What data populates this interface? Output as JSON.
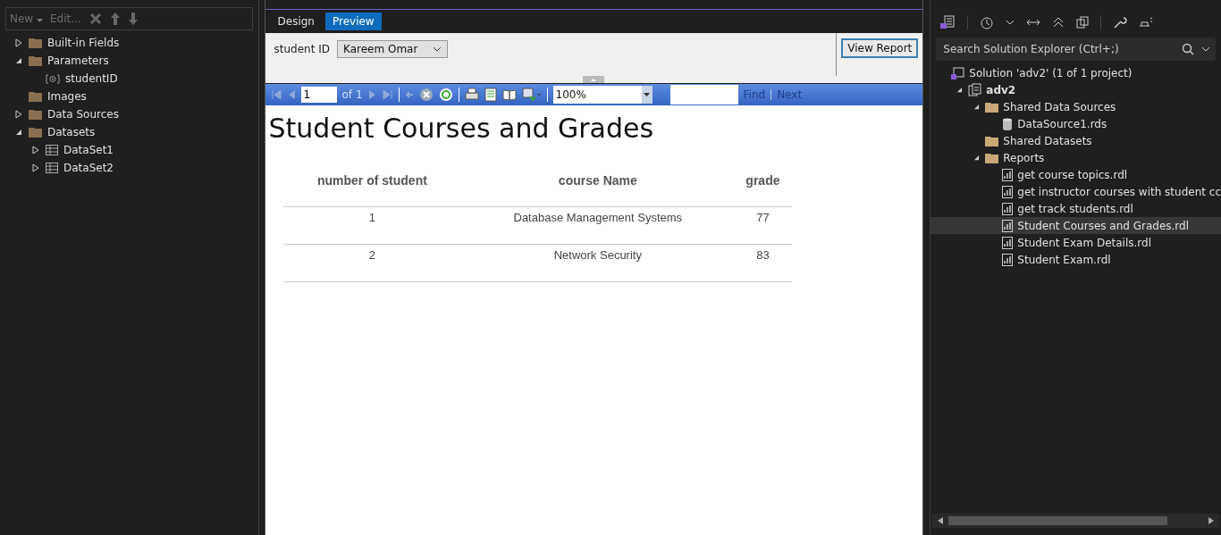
{
  "report_data": {
    "toolbar": {
      "new": "New",
      "edit": "Edit..."
    },
    "items": [
      {
        "label": "Built-in Fields",
        "kind": "folder",
        "expanded": false
      },
      {
        "label": "Parameters",
        "kind": "folder",
        "expanded": true,
        "children": [
          {
            "label": "studentID",
            "kind": "parameter"
          }
        ]
      },
      {
        "label": "Images",
        "kind": "folder"
      },
      {
        "label": "Data Sources",
        "kind": "folder",
        "expanded": false
      },
      {
        "label": "Datasets",
        "kind": "folder",
        "expanded": true,
        "children": [
          {
            "label": "DataSet1",
            "kind": "table",
            "expanded": false
          },
          {
            "label": "DataSet2",
            "kind": "table",
            "expanded": false
          }
        ]
      }
    ]
  },
  "designer": {
    "tabs": [
      {
        "label": "Design",
        "selected": false
      },
      {
        "label": "Preview",
        "selected": true
      }
    ],
    "parameter": {
      "label": "student ID",
      "value": "Kareem Omar"
    },
    "view_report": "View Report",
    "pager": {
      "page": "1",
      "of": "of 1",
      "zoom": "100%",
      "find": "Find",
      "next": "Next"
    },
    "report": {
      "title": "Student Courses and Grades",
      "columns": [
        "number of student",
        "course Name",
        "grade"
      ],
      "rows": [
        [
          "1",
          "Database Management Systems",
          "77"
        ],
        [
          "2",
          "Network Security",
          "83"
        ]
      ]
    }
  },
  "solution_explorer": {
    "search": {
      "placeholder": "Search Solution Explorer (Ctrl+;)"
    },
    "tree": [
      {
        "label": "Solution 'adv2' (1 of 1 project)",
        "kind": "solution",
        "bold": false,
        "selected": false,
        "children": [
          {
            "label": "adv2",
            "kind": "project",
            "bold": true,
            "selected": false,
            "expanded": true,
            "children": [
              {
                "label": "Shared Data Sources",
                "kind": "folder",
                "bold": false,
                "selected": false,
                "expanded": true,
                "children": [
                  {
                    "label": "DataSource1.rds",
                    "kind": "database",
                    "bold": false,
                    "selected": false
                  }
                ]
              },
              {
                "label": "Shared Datasets",
                "kind": "folder",
                "bold": false,
                "selected": false
              },
              {
                "label": "Reports",
                "kind": "folder",
                "bold": false,
                "selected": false,
                "expanded": true,
                "children": [
                  {
                    "label": "get course topics.rdl",
                    "kind": "report",
                    "bold": false,
                    "selected": false
                  },
                  {
                    "label": "get instructor courses with student cc",
                    "kind": "report",
                    "bold": false,
                    "selected": false
                  },
                  {
                    "label": "get track students.rdl",
                    "kind": "report",
                    "bold": false,
                    "selected": false
                  },
                  {
                    "label": "Student Courses and Grades.rdl",
                    "kind": "report",
                    "bold": false,
                    "selected": true
                  },
                  {
                    "label": "Student Exam Details.rdl",
                    "kind": "report",
                    "bold": false,
                    "selected": false
                  },
                  {
                    "label": "Student Exam.rdl",
                    "kind": "report",
                    "bold": false,
                    "selected": false
                  }
                ]
              }
            ]
          }
        ]
      }
    ]
  }
}
